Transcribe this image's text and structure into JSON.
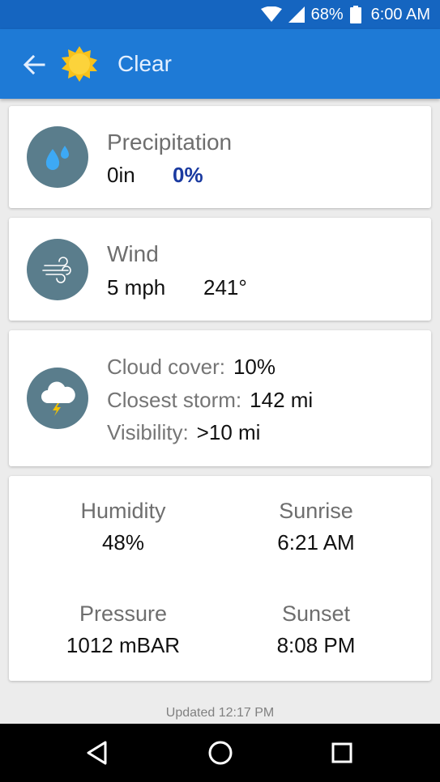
{
  "status_bar": {
    "battery": "68%",
    "time": "6:00 AM"
  },
  "header": {
    "title": "Clear",
    "icons": {
      "back": "arrow-left",
      "weather": "sun"
    }
  },
  "precipitation": {
    "title": "Precipitation",
    "amount": "0in",
    "chance": "0%",
    "icon": "raindrops"
  },
  "wind": {
    "title": "Wind",
    "speed": "5 mph",
    "direction": "241°",
    "icon": "wind"
  },
  "conditions": {
    "icon": "cloud-lightning",
    "rows": [
      {
        "label": "Cloud cover:",
        "value": "10%"
      },
      {
        "label": "Closest storm:",
        "value": "142 mi"
      },
      {
        "label": "Visibility:",
        "value": ">10 mi"
      }
    ]
  },
  "stats": {
    "humidity_label": "Humidity",
    "humidity": "48%",
    "sunrise_label": "Sunrise",
    "sunrise": "6:21 AM",
    "pressure_label": "Pressure",
    "pressure": "1012 mBAR",
    "sunset_label": "Sunset",
    "sunset": "8:08 PM"
  },
  "footer": {
    "updated": "Updated 12:17 PM"
  },
  "colors": {
    "app_bar": "#1e7ad6",
    "status_bar": "#1565c0",
    "icon_circle": "#5a7d8c",
    "accent": "#1a3aa0",
    "rain_drop": "#3da9f5",
    "lightning": "#f2c200"
  }
}
